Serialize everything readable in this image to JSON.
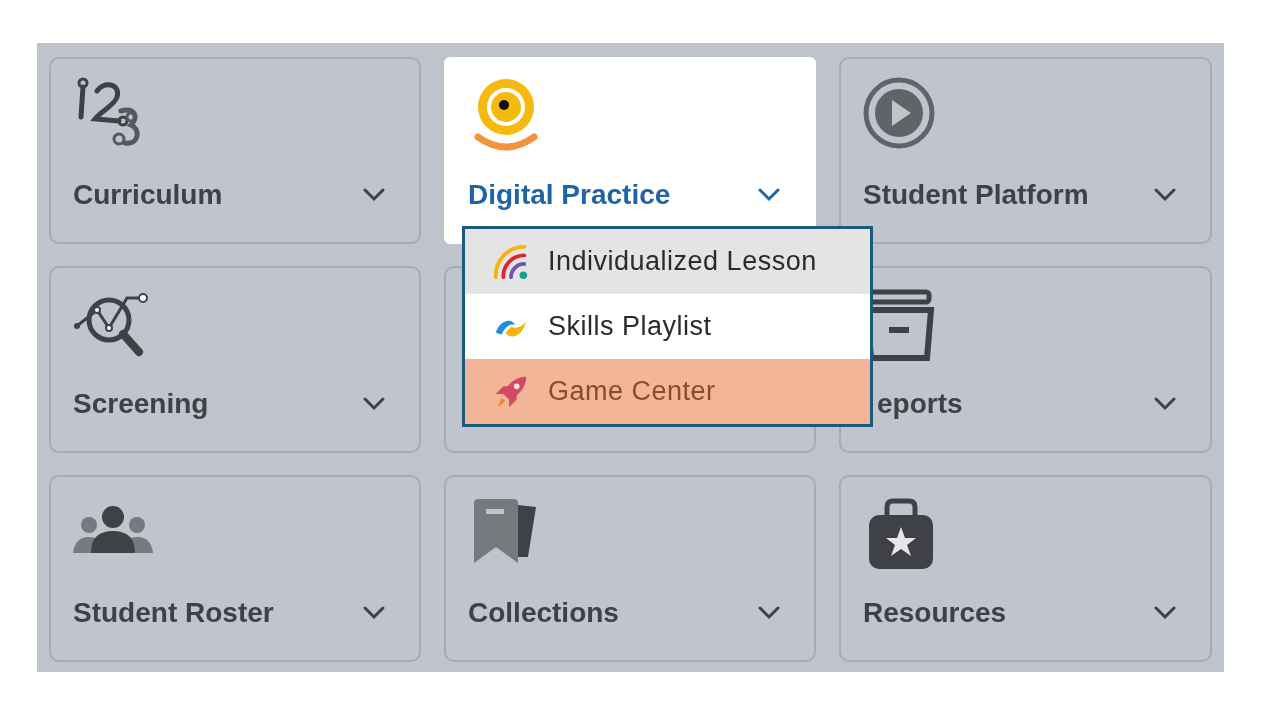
{
  "cards": [
    {
      "label": "Curriculum",
      "open": false
    },
    {
      "label": "Digital Practice",
      "open": true
    },
    {
      "label": "Student Platform",
      "open": false
    },
    {
      "label": "Screening",
      "open": false
    },
    {
      "open": false
    },
    {
      "label": "eports",
      "open": false,
      "covered": true
    },
    {
      "label": "Student Roster",
      "open": false
    },
    {
      "label": "Collections",
      "open": false
    },
    {
      "label": "Resources",
      "open": false
    }
  ],
  "dropdown": {
    "items": [
      {
        "label": "Individualized Lesson",
        "highlighted": true,
        "selected": false
      },
      {
        "label": "Skills Playlist",
        "highlighted": false,
        "selected": false
      },
      {
        "label": "Game Center",
        "highlighted": false,
        "selected": true
      }
    ]
  }
}
